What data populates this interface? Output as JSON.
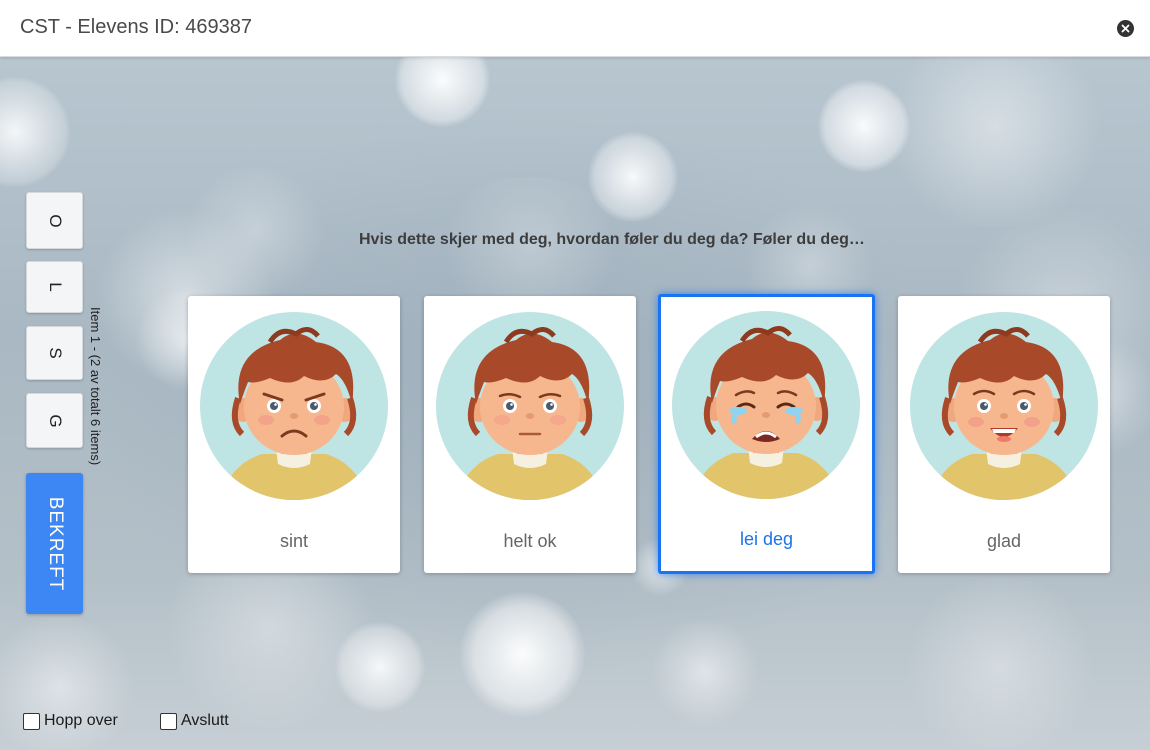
{
  "header": {
    "title": "CST - Elevens ID: 469387",
    "close_icon": "close-icon"
  },
  "side_buttons": [
    {
      "label": "O"
    },
    {
      "label": "L"
    },
    {
      "label": "S"
    },
    {
      "label": "G"
    }
  ],
  "confirm": {
    "label": "BEKREFT",
    "color": "#3d87f5"
  },
  "item_counter": "Item 1 - (2 av totalt 6 items)",
  "question": "Hvis dette skjer med deg, hvordan føler du deg da? Føler du deg…",
  "options": [
    {
      "label": "sint",
      "emotion": "angry",
      "selected": false
    },
    {
      "label": "helt ok",
      "emotion": "neutral",
      "selected": false
    },
    {
      "label": "lei deg",
      "emotion": "crying",
      "selected": true
    },
    {
      "label": "glad",
      "emotion": "happy",
      "selected": false
    }
  ],
  "footer": {
    "skip_label": "Hopp over",
    "quit_label": "Avslutt",
    "skip_checked": false,
    "quit_checked": false
  },
  "colors": {
    "accent": "#1a73f0",
    "face_bg": "#bfe4e4"
  }
}
